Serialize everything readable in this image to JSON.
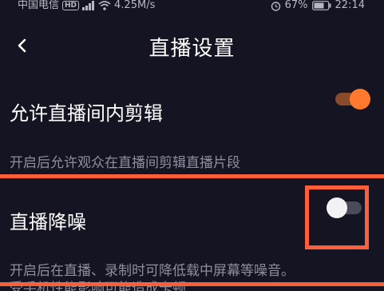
{
  "status_bar": {
    "carrier": "中国电信",
    "hd_badge": "HD",
    "network_speed": "4.25M/s",
    "battery_percent": "67%",
    "time": "22:14"
  },
  "header": {
    "title": "直播设置"
  },
  "settings": [
    {
      "label": "允许直播间内剪辑",
      "description": "开启后允许观众在直播间剪辑直播片段",
      "enabled": true
    },
    {
      "label": "直播降噪",
      "description_line1": "开启后在直播、录制时可降低载中屏幕等噪音。",
      "description_line2": "受手机性能影响可能造成卡顿",
      "enabled": false
    }
  ],
  "colors": {
    "background": "#151422",
    "accent_orange": "#ff7a2e",
    "highlight_border": "#ff5e3a"
  }
}
